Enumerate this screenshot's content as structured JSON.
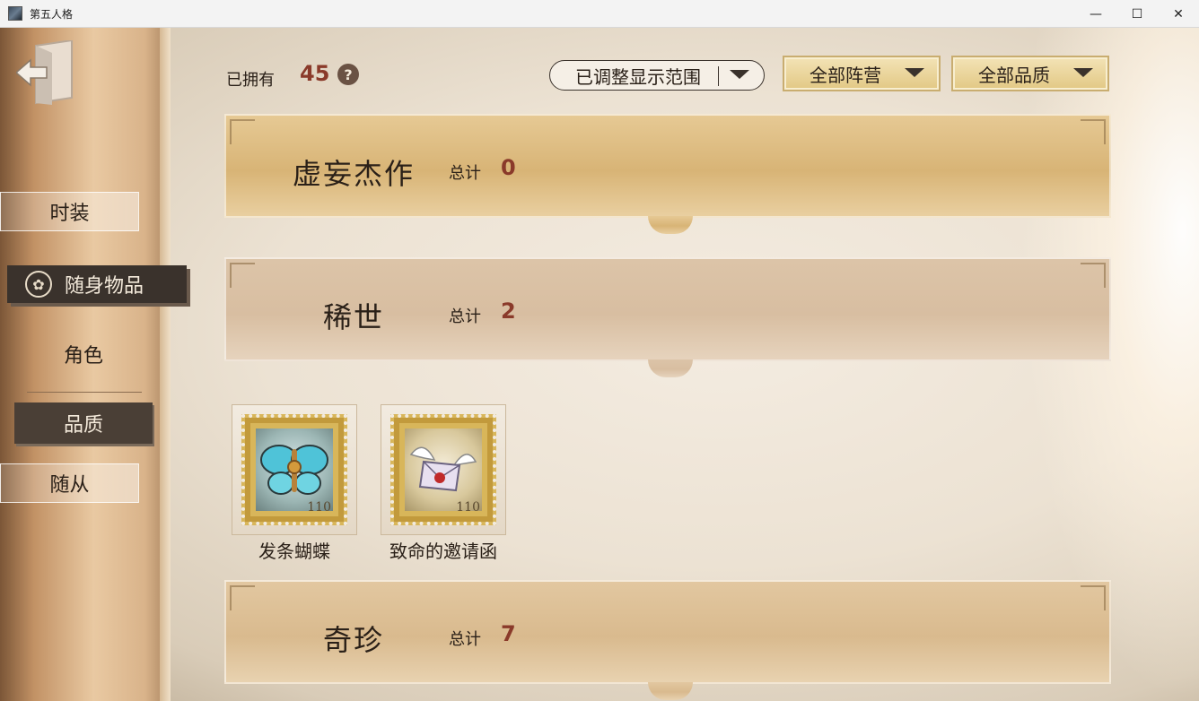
{
  "window": {
    "title": "第五人格",
    "minimize": "—",
    "maximize": "☐",
    "close": "✕"
  },
  "sidebar": {
    "tabs": [
      {
        "label": "时装"
      },
      {
        "label": "随身物品"
      },
      {
        "label": "角色"
      },
      {
        "label": "品质"
      },
      {
        "label": "随从"
      }
    ]
  },
  "header": {
    "owned_label": "已拥有",
    "owned_count": "45",
    "help": "?",
    "filters": [
      {
        "label": "已调整显示范围"
      },
      {
        "label": "全部阵营"
      },
      {
        "label": "全部品质"
      }
    ]
  },
  "categories": [
    {
      "name": "虚妄杰作",
      "total_label": "总计",
      "count": "0"
    },
    {
      "name": "稀世",
      "total_label": "总计",
      "count": "2"
    },
    {
      "name": "奇珍",
      "total_label": "总计",
      "count": "7"
    }
  ],
  "items": [
    {
      "name": "发条蝴蝶",
      "stamp_number": "110",
      "icon": "butterfly-icon"
    },
    {
      "name": "致命的邀请函",
      "stamp_number": "110",
      "icon": "winged-letter-icon"
    }
  ]
}
